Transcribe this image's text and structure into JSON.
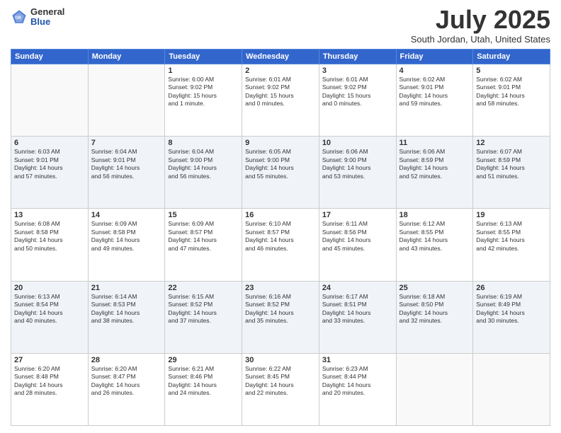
{
  "header": {
    "logo_general": "General",
    "logo_blue": "Blue",
    "month_title": "July 2025",
    "subtitle": "South Jordan, Utah, United States"
  },
  "days_of_week": [
    "Sunday",
    "Monday",
    "Tuesday",
    "Wednesday",
    "Thursday",
    "Friday",
    "Saturday"
  ],
  "weeks": [
    [
      {
        "day": "",
        "info": ""
      },
      {
        "day": "",
        "info": ""
      },
      {
        "day": "1",
        "info": "Sunrise: 6:00 AM\nSunset: 9:02 PM\nDaylight: 15 hours\nand 1 minute."
      },
      {
        "day": "2",
        "info": "Sunrise: 6:01 AM\nSunset: 9:02 PM\nDaylight: 15 hours\nand 0 minutes."
      },
      {
        "day": "3",
        "info": "Sunrise: 6:01 AM\nSunset: 9:02 PM\nDaylight: 15 hours\nand 0 minutes."
      },
      {
        "day": "4",
        "info": "Sunrise: 6:02 AM\nSunset: 9:01 PM\nDaylight: 14 hours\nand 59 minutes."
      },
      {
        "day": "5",
        "info": "Sunrise: 6:02 AM\nSunset: 9:01 PM\nDaylight: 14 hours\nand 58 minutes."
      }
    ],
    [
      {
        "day": "6",
        "info": "Sunrise: 6:03 AM\nSunset: 9:01 PM\nDaylight: 14 hours\nand 57 minutes."
      },
      {
        "day": "7",
        "info": "Sunrise: 6:04 AM\nSunset: 9:01 PM\nDaylight: 14 hours\nand 56 minutes."
      },
      {
        "day": "8",
        "info": "Sunrise: 6:04 AM\nSunset: 9:00 PM\nDaylight: 14 hours\nand 56 minutes."
      },
      {
        "day": "9",
        "info": "Sunrise: 6:05 AM\nSunset: 9:00 PM\nDaylight: 14 hours\nand 55 minutes."
      },
      {
        "day": "10",
        "info": "Sunrise: 6:06 AM\nSunset: 9:00 PM\nDaylight: 14 hours\nand 53 minutes."
      },
      {
        "day": "11",
        "info": "Sunrise: 6:06 AM\nSunset: 8:59 PM\nDaylight: 14 hours\nand 52 minutes."
      },
      {
        "day": "12",
        "info": "Sunrise: 6:07 AM\nSunset: 8:59 PM\nDaylight: 14 hours\nand 51 minutes."
      }
    ],
    [
      {
        "day": "13",
        "info": "Sunrise: 6:08 AM\nSunset: 8:58 PM\nDaylight: 14 hours\nand 50 minutes."
      },
      {
        "day": "14",
        "info": "Sunrise: 6:09 AM\nSunset: 8:58 PM\nDaylight: 14 hours\nand 49 minutes."
      },
      {
        "day": "15",
        "info": "Sunrise: 6:09 AM\nSunset: 8:57 PM\nDaylight: 14 hours\nand 47 minutes."
      },
      {
        "day": "16",
        "info": "Sunrise: 6:10 AM\nSunset: 8:57 PM\nDaylight: 14 hours\nand 46 minutes."
      },
      {
        "day": "17",
        "info": "Sunrise: 6:11 AM\nSunset: 8:56 PM\nDaylight: 14 hours\nand 45 minutes."
      },
      {
        "day": "18",
        "info": "Sunrise: 6:12 AM\nSunset: 8:55 PM\nDaylight: 14 hours\nand 43 minutes."
      },
      {
        "day": "19",
        "info": "Sunrise: 6:13 AM\nSunset: 8:55 PM\nDaylight: 14 hours\nand 42 minutes."
      }
    ],
    [
      {
        "day": "20",
        "info": "Sunrise: 6:13 AM\nSunset: 8:54 PM\nDaylight: 14 hours\nand 40 minutes."
      },
      {
        "day": "21",
        "info": "Sunrise: 6:14 AM\nSunset: 8:53 PM\nDaylight: 14 hours\nand 38 minutes."
      },
      {
        "day": "22",
        "info": "Sunrise: 6:15 AM\nSunset: 8:52 PM\nDaylight: 14 hours\nand 37 minutes."
      },
      {
        "day": "23",
        "info": "Sunrise: 6:16 AM\nSunset: 8:52 PM\nDaylight: 14 hours\nand 35 minutes."
      },
      {
        "day": "24",
        "info": "Sunrise: 6:17 AM\nSunset: 8:51 PM\nDaylight: 14 hours\nand 33 minutes."
      },
      {
        "day": "25",
        "info": "Sunrise: 6:18 AM\nSunset: 8:50 PM\nDaylight: 14 hours\nand 32 minutes."
      },
      {
        "day": "26",
        "info": "Sunrise: 6:19 AM\nSunset: 8:49 PM\nDaylight: 14 hours\nand 30 minutes."
      }
    ],
    [
      {
        "day": "27",
        "info": "Sunrise: 6:20 AM\nSunset: 8:48 PM\nDaylight: 14 hours\nand 28 minutes."
      },
      {
        "day": "28",
        "info": "Sunrise: 6:20 AM\nSunset: 8:47 PM\nDaylight: 14 hours\nand 26 minutes."
      },
      {
        "day": "29",
        "info": "Sunrise: 6:21 AM\nSunset: 8:46 PM\nDaylight: 14 hours\nand 24 minutes."
      },
      {
        "day": "30",
        "info": "Sunrise: 6:22 AM\nSunset: 8:45 PM\nDaylight: 14 hours\nand 22 minutes."
      },
      {
        "day": "31",
        "info": "Sunrise: 6:23 AM\nSunset: 8:44 PM\nDaylight: 14 hours\nand 20 minutes."
      },
      {
        "day": "",
        "info": ""
      },
      {
        "day": "",
        "info": ""
      }
    ]
  ]
}
